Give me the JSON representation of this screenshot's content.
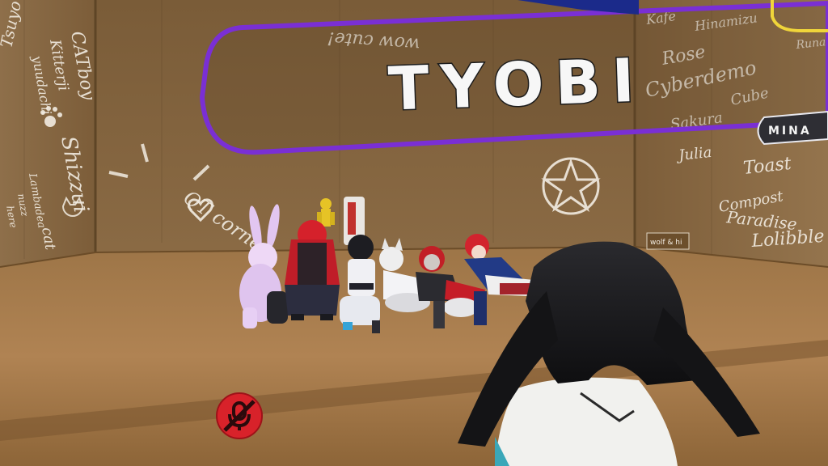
{
  "scene": {
    "sign_text": "TYOBI",
    "wall_tag": "wow cute!",
    "corner_label": "QT corner",
    "nameplate_label": "MINA",
    "right_wall_sign": "wolf & hi",
    "left_wall_doodles": [
      "Tsuyo",
      "CATboy",
      "Kitterji",
      "yuudachi",
      "Shizzui",
      "Lambadea",
      "nuzz",
      "here",
      "cat"
    ],
    "right_wall_doodles": [
      "Kafe",
      "Hinamizu",
      "Rose",
      "Cyberdemo",
      "Cube",
      "Sakura",
      "Julia",
      "Toast",
      "Compost",
      "Paradise",
      "Lolibble",
      "Runa"
    ]
  },
  "colors": {
    "wall": "#8a6a44",
    "floor": "#a97f4e",
    "sign_border": "#7a2fd4",
    "mute_button": "#d8222a"
  },
  "hud": {
    "mute_icon": "microphone-muted-icon"
  }
}
